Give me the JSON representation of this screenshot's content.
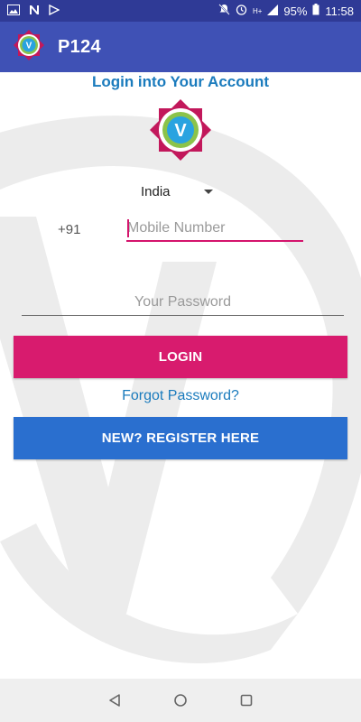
{
  "status_bar": {
    "battery": "95%",
    "time": "11:58",
    "network": "H+"
  },
  "app_bar": {
    "title": "P124"
  },
  "login": {
    "heading": "Login into Your Account",
    "country": "India",
    "country_code": "+91",
    "mobile_placeholder": "Mobile Number",
    "password_placeholder": "Your Password",
    "login_button": "LOGIN",
    "forgot_link": "Forgot Password?",
    "register_button": "NEW? REGISTER HERE"
  },
  "logo": {
    "letter": "V",
    "colors": {
      "outer": "#c2185b",
      "ring": "#8bc34a",
      "inner": "#29a3e0"
    }
  },
  "colors": {
    "app_bar": "#3f51b5",
    "status_bar": "#2f3a96",
    "accent_pink": "#d81b6e",
    "register_blue": "#2a6fcf",
    "link_blue": "#1a7bbd"
  }
}
